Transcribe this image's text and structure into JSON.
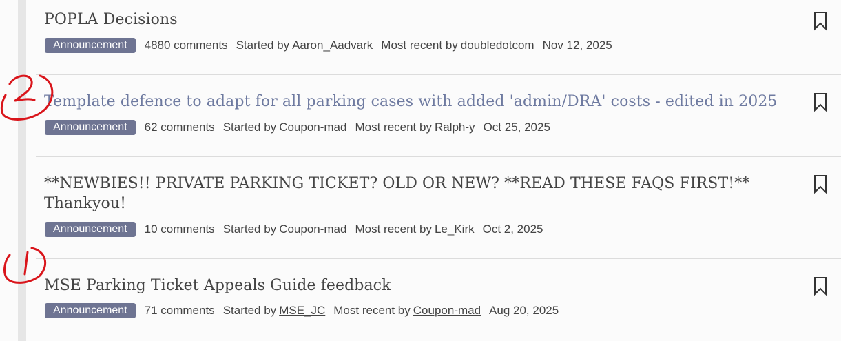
{
  "threads": [
    {
      "title": "POPLA Decisions",
      "badge": "Announcement",
      "comments": "4880 comments",
      "started_label": "Started by",
      "started_by": "Aaron_Aadvark",
      "recent_label": "Most recent by",
      "recent_by": "doubledotcom",
      "date": "Nov 12, 2025"
    },
    {
      "title": "Template defence to adapt for all parking cases with added 'admin/DRA' costs - edited in 2025",
      "badge": "Announcement",
      "comments": "62 comments",
      "started_label": "Started by",
      "started_by": "Coupon-mad",
      "recent_label": "Most recent by",
      "recent_by": "Ralph-y",
      "date": "Oct 25, 2025"
    },
    {
      "title": "**NEWBIES!! PRIVATE PARKING TICKET? OLD OR NEW? **READ THESE FAQS FIRST!** Thankyou!",
      "badge": "Announcement",
      "comments": "10 comments",
      "started_label": "Started by",
      "started_by": "Coupon-mad",
      "recent_label": "Most recent by",
      "recent_by": "Le_Kirk",
      "date": "Oct 2, 2025"
    },
    {
      "title": "MSE Parking Ticket Appeals Guide feedback",
      "badge": "Announcement",
      "comments": "71 comments",
      "started_label": "Started by",
      "started_by": "MSE_JC",
      "recent_label": "Most recent by",
      "recent_by": "Coupon-mad",
      "date": "Aug 20, 2025"
    }
  ],
  "annotations": [
    "2",
    "1"
  ],
  "colors": {
    "badge_bg": "#6e7492",
    "visited_title": "#6e7aa0",
    "annotation_red": "#d9151b",
    "left_rail": "#e6e6e6"
  },
  "icons": {
    "bookmark": "bookmark-icon"
  }
}
